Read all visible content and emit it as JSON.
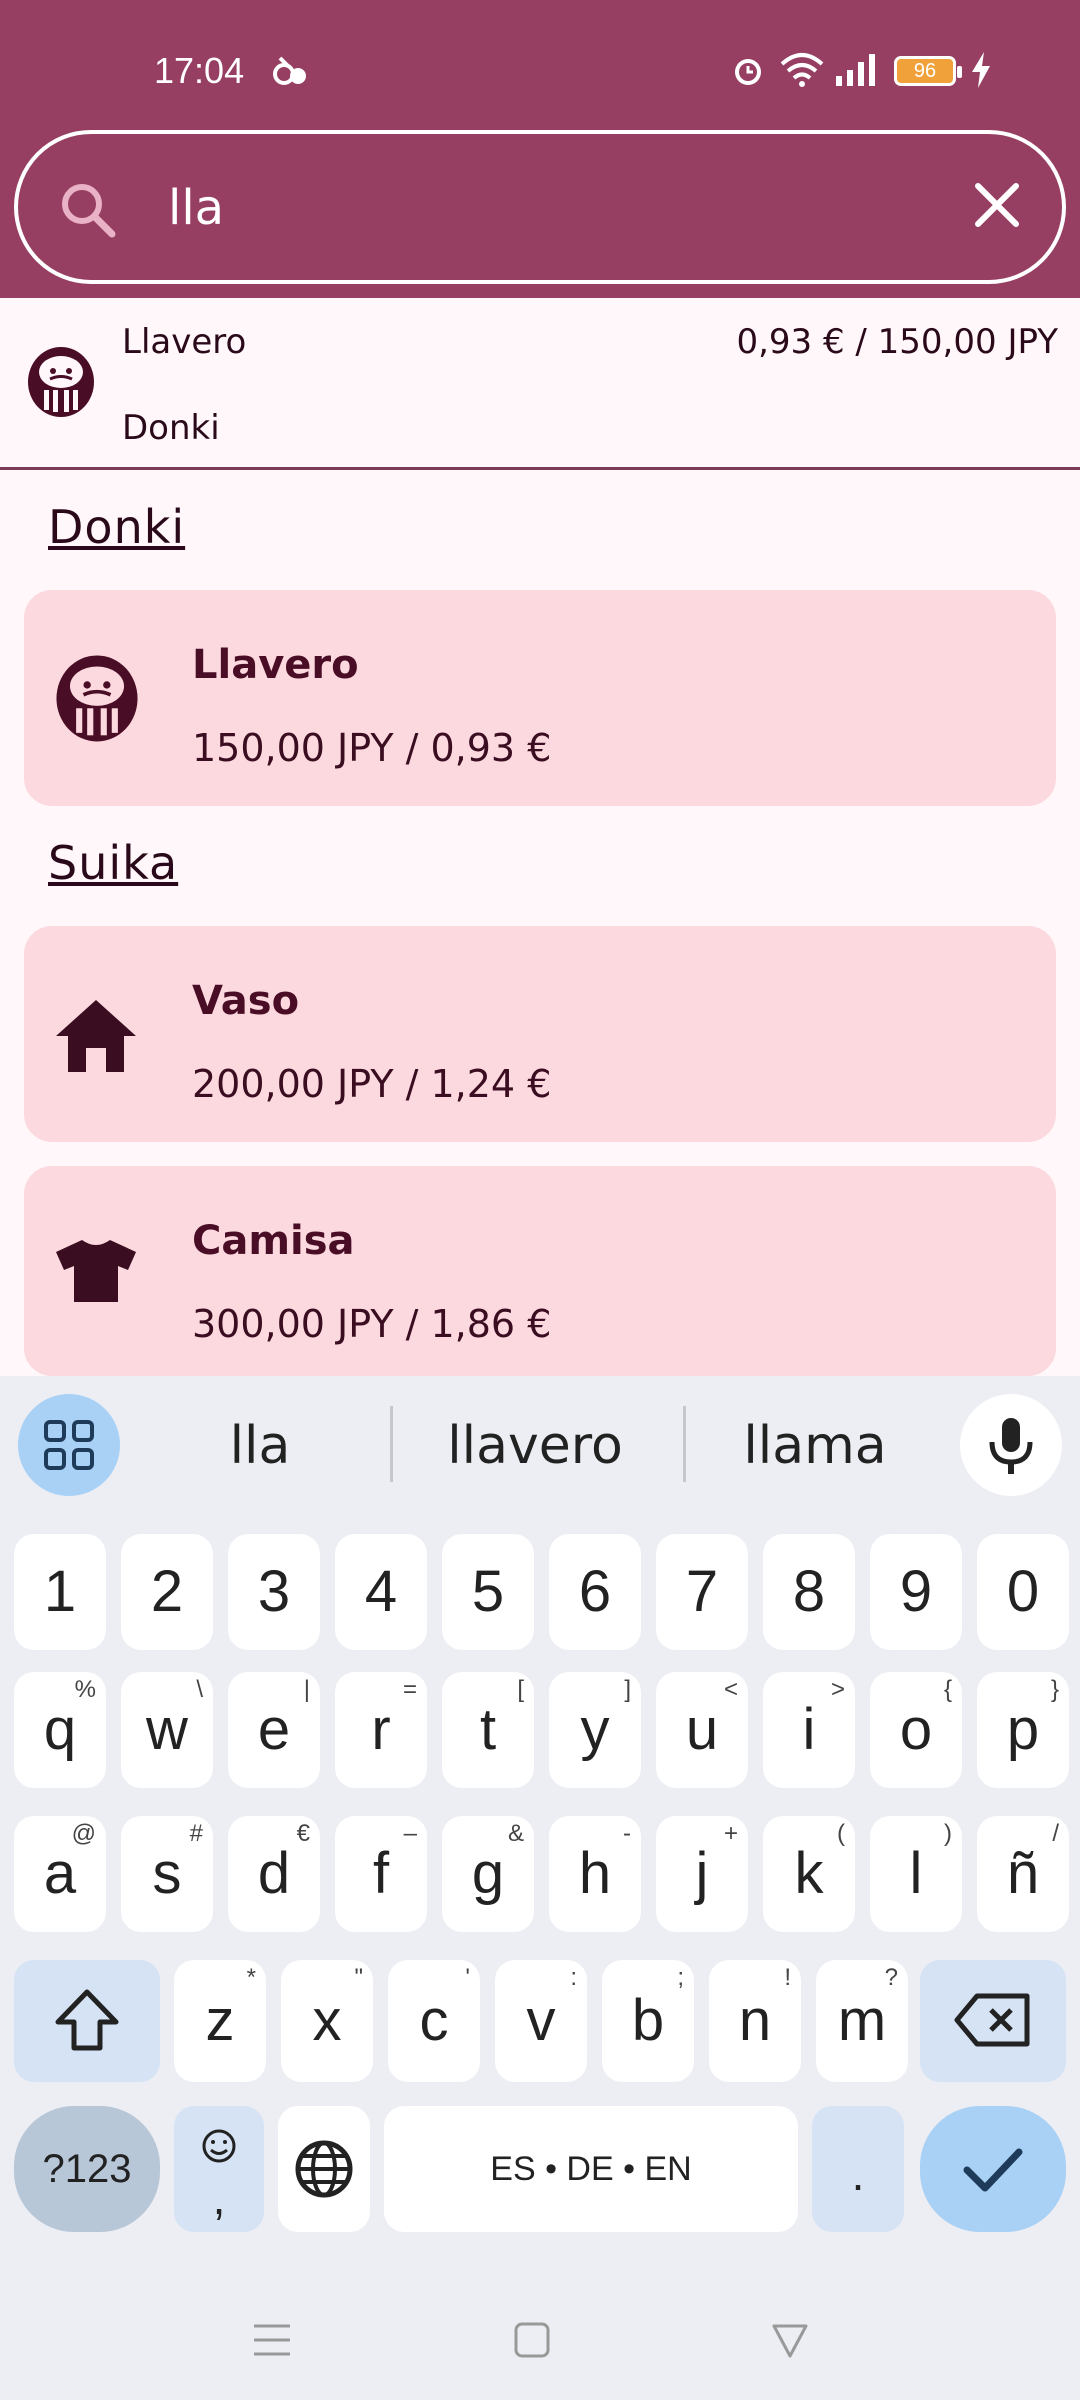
{
  "status_bar": {
    "time": "17:04",
    "battery": "96"
  },
  "search": {
    "value": "lla"
  },
  "suggestion": {
    "name": "Llavero",
    "price": "0,93 € / 150,00 JPY",
    "store": "Donki"
  },
  "sections": [
    {
      "title": "Donki",
      "items": [
        {
          "name": "Llavero",
          "price": "150,00 JPY / 0,93 €",
          "icon": "daruma-icon"
        }
      ]
    },
    {
      "title": "Suika",
      "items": [
        {
          "name": "Vaso",
          "price": "200,00 JPY / 1,24 €",
          "icon": "house-icon"
        },
        {
          "name": "Camisa",
          "price": "300,00 JPY / 1,86 €",
          "icon": "shirt-icon"
        }
      ]
    }
  ],
  "keyboard": {
    "suggestions": [
      "lla",
      "llavero",
      "llama"
    ],
    "row_numbers": [
      "1",
      "2",
      "3",
      "4",
      "5",
      "6",
      "7",
      "8",
      "9",
      "0"
    ],
    "row_q": [
      {
        "k": "q",
        "s": "%"
      },
      {
        "k": "w",
        "s": "\\"
      },
      {
        "k": "e",
        "s": "|"
      },
      {
        "k": "r",
        "s": "="
      },
      {
        "k": "t",
        "s": "["
      },
      {
        "k": "y",
        "s": "]"
      },
      {
        "k": "u",
        "s": "<"
      },
      {
        "k": "i",
        "s": ">"
      },
      {
        "k": "o",
        "s": "{"
      },
      {
        "k": "p",
        "s": "}"
      }
    ],
    "row_a": [
      {
        "k": "a",
        "s": "@"
      },
      {
        "k": "s",
        "s": "#"
      },
      {
        "k": "d",
        "s": "€"
      },
      {
        "k": "f",
        "s": "–"
      },
      {
        "k": "g",
        "s": "&"
      },
      {
        "k": "h",
        "s": "-"
      },
      {
        "k": "j",
        "s": "+"
      },
      {
        "k": "k",
        "s": "("
      },
      {
        "k": "l",
        "s": ")"
      },
      {
        "k": "ñ",
        "s": "/"
      }
    ],
    "row_z": [
      {
        "k": "z",
        "s": "*"
      },
      {
        "k": "x",
        "s": "\""
      },
      {
        "k": "c",
        "s": "'"
      },
      {
        "k": "v",
        "s": ":"
      },
      {
        "k": "b",
        "s": ";"
      },
      {
        "k": "n",
        "s": "!"
      },
      {
        "k": "m",
        "s": "?"
      }
    ],
    "symbols_label": "?123",
    "emoji_comma": ",",
    "space_label": "ES • DE • EN",
    "period_label": "."
  },
  "colors": {
    "header": "#973f62",
    "card": "#fcd8df",
    "accent_key": "#a9d0f5",
    "icon": "#4a0d26"
  }
}
